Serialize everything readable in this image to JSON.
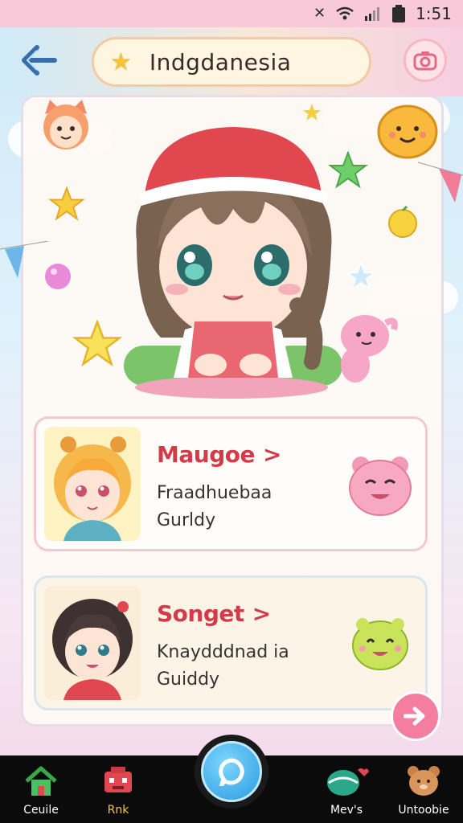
{
  "status_bar": {
    "time": "1:51",
    "icons": [
      "bluetooth-icon",
      "wifi-icon",
      "signal-icon",
      "battery-icon"
    ]
  },
  "header": {
    "title": "Indgdanesia",
    "back_icon": "arrow-left-icon",
    "title_icon": "star-icon",
    "menu_icon": "camera-icon"
  },
  "friends": [
    {
      "name": "Maugoe",
      "line1": "Fraadhuebaa",
      "line2": "Gurldy"
    },
    {
      "name": "Songet",
      "line1": "Knaydddnad ia",
      "line2": "Guiddy"
    }
  ],
  "nav": {
    "items": [
      {
        "label": "Ceuile",
        "icon": "house-icon"
      },
      {
        "label": "Rnk",
        "icon": "robot-icon"
      },
      {
        "label": "",
        "icon": "chat-bubble-icon"
      },
      {
        "label": "Mev's",
        "icon": "globe-icon"
      },
      {
        "label": "Untoobie",
        "icon": "bear-icon"
      }
    ]
  },
  "colors": {
    "status_bar": "#f7c9d9",
    "accent_pink": "#f37ea0",
    "name_red": "#d43b48",
    "nav_active": "#f7c548",
    "nav_bg": "#0b0b0b"
  }
}
